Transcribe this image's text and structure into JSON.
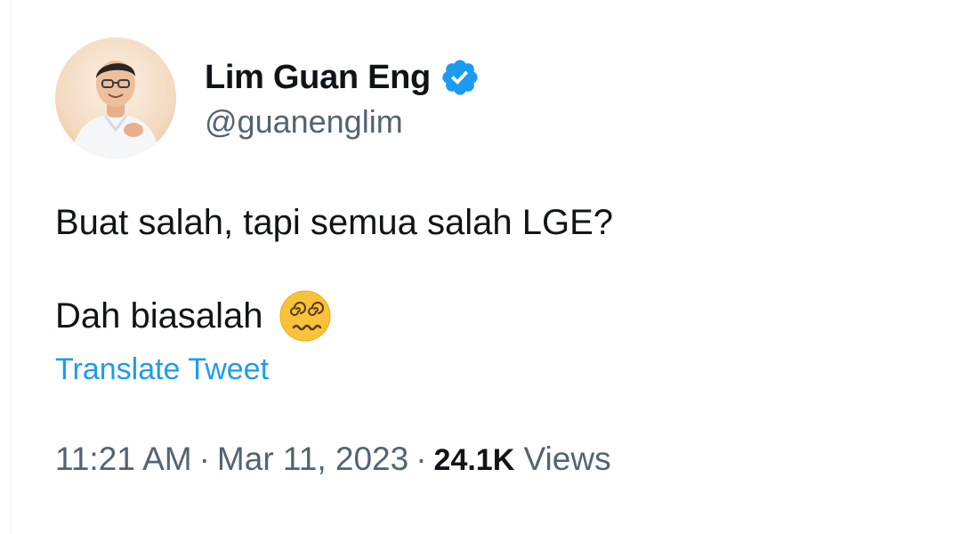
{
  "author": {
    "display_name": "Lim Guan Eng",
    "handle": "@guanenglim",
    "verified_icon": "verified-badge-icon",
    "badge_color": "#1d9bf0"
  },
  "tweet": {
    "line1": "Buat salah, tapi semua salah LGE?",
    "line2": "Dah biasalah",
    "emoji": "dizzy-face-emoji",
    "translate_label": "Translate Tweet"
  },
  "meta": {
    "time": "11:21 AM",
    "separator": "·",
    "date": "Mar 11, 2023",
    "views_count": "24.1K",
    "views_label": "Views"
  },
  "colors": {
    "text": "#0f1419",
    "secondary": "#536471",
    "link": "#1d9bf0"
  }
}
